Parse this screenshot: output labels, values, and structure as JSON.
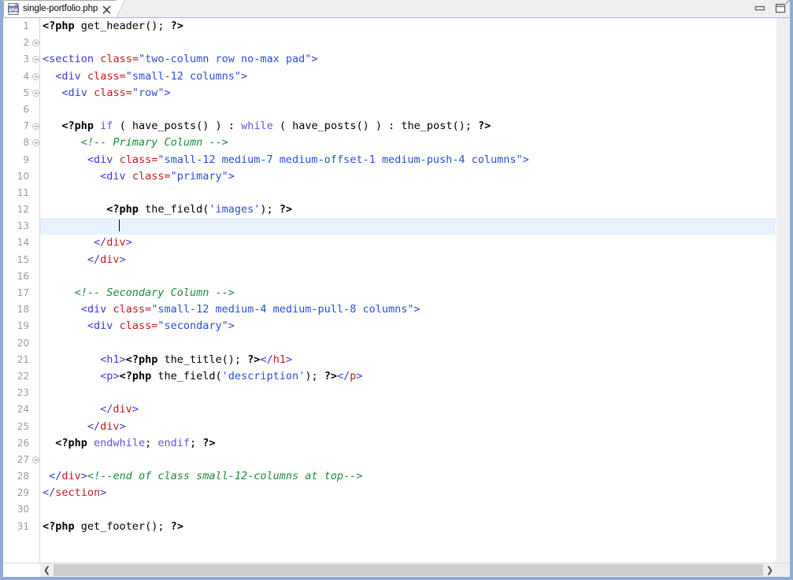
{
  "window": {
    "title": "single-portfolio.php",
    "minimize_label": "Minimize",
    "maximize_label": "Maximize"
  },
  "tab": {
    "label": "single-portfolio.php",
    "icon": "php-file-icon",
    "close_label": "Close tab"
  },
  "editor": {
    "language": "PHP / HTML",
    "cursor_line": 13,
    "total_lines": 31,
    "colors": {
      "background": "#ffffff",
      "current_line_highlight": "#e8f2fe",
      "line_number": "#9a9a9a",
      "keyword": "#6a4fe0",
      "string": "#2a4ed6",
      "tag": "#3a3ad0",
      "closing_tag_name": "#c21b1b",
      "attribute": "#c21b1b",
      "attribute_value": "#2a4ed6",
      "comment": "#1d8a3a",
      "php_delimiter": "#000000",
      "frame_border": "#8fabdb"
    },
    "line_numbers": [
      1,
      2,
      3,
      4,
      5,
      6,
      7,
      8,
      9,
      10,
      11,
      12,
      13,
      14,
      15,
      16,
      17,
      18,
      19,
      20,
      21,
      22,
      23,
      24,
      25,
      26,
      27,
      28,
      29,
      30,
      31
    ],
    "folding_rows": [
      2,
      3,
      4,
      5,
      7,
      8,
      27
    ],
    "lines": [
      {
        "n": 1,
        "text": "<?php get_header(); ?>"
      },
      {
        "n": 2,
        "text": ""
      },
      {
        "n": 3,
        "text": "<section class=\"two-column row no-max pad\">"
      },
      {
        "n": 4,
        "text": "  <div class=\"small-12 columns\">"
      },
      {
        "n": 5,
        "text": "   <div class=\"row\">"
      },
      {
        "n": 6,
        "text": ""
      },
      {
        "n": 7,
        "text": "   <?php if ( have_posts() ) : while ( have_posts() ) : the_post(); ?>"
      },
      {
        "n": 8,
        "text": "      <!-- Primary Column -->"
      },
      {
        "n": 9,
        "text": "       <div class=\"small-12 medium-7 medium-offset-1 medium-push-4 columns\">"
      },
      {
        "n": 10,
        "text": "         <div class=\"primary\">"
      },
      {
        "n": 11,
        "text": ""
      },
      {
        "n": 12,
        "text": "          <?php the_field('images'); ?>"
      },
      {
        "n": 13,
        "text": ""
      },
      {
        "n": 14,
        "text": "        </div>"
      },
      {
        "n": 15,
        "text": "       </div>"
      },
      {
        "n": 16,
        "text": ""
      },
      {
        "n": 17,
        "text": "     <!-- Secondary Column -->"
      },
      {
        "n": 18,
        "text": "      <div class=\"small-12 medium-4 medium-pull-8 columns\">"
      },
      {
        "n": 19,
        "text": "       <div class=\"secondary\">"
      },
      {
        "n": 20,
        "text": ""
      },
      {
        "n": 21,
        "text": "         <h1><?php the_title(); ?></h1>"
      },
      {
        "n": 22,
        "text": "         <p><?php the_field('description'); ?></p>"
      },
      {
        "n": 23,
        "text": ""
      },
      {
        "n": 24,
        "text": "         </div>"
      },
      {
        "n": 25,
        "text": "       </div>"
      },
      {
        "n": 26,
        "text": "  <?php endwhile; endif; ?>"
      },
      {
        "n": 27,
        "text": ""
      },
      {
        "n": 28,
        "text": " </div><!--end of class small-12-columns at top-->"
      },
      {
        "n": 29,
        "text": "</section>"
      },
      {
        "n": 30,
        "text": ""
      },
      {
        "n": 31,
        "text": "<?php get_footer(); ?>"
      }
    ]
  },
  "scrollbars": {
    "h_left_arrow": "❮",
    "h_right_arrow": "❯"
  }
}
